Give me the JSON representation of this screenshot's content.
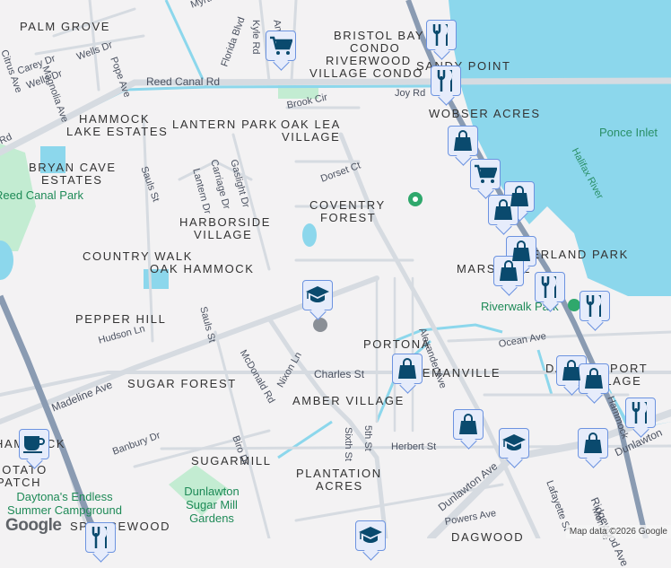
{
  "map": {
    "colors": {
      "land": "#f3f2f3",
      "water": "#8cd7ec",
      "road": "#d6dbe1",
      "highway": "#8a9bb2",
      "park": "#c3ecd2",
      "marker_icon": "#0a4a6e"
    },
    "neighborhoods": [
      "PALM GROVE",
      "BRISTOL BAY",
      "CONDO",
      "RIVERWOOD",
      "VILLAGE CONDO",
      "SANDY POINT",
      "HAMMOCK",
      "LAKE ESTATES",
      "LANTERN PARK",
      "OAK LEA",
      "VILLAGE",
      "WOBSER ACRES",
      "BRYAN CAVE",
      "ESTATES",
      "COVENTRY",
      "FOREST",
      "HARBORSIDE",
      "VILLAGE",
      "COUNTRY WALK",
      "OAK HAMMOCK",
      "RIVERLAND PARK",
      "MARSHALL",
      "PEPPER HILL",
      "PORTONA",
      "FREEMANVILLE",
      "SUGAR FOREST",
      "AMBER VILLAGE",
      "DANIELS PORT",
      "VILLAGE",
      "HAMMOCK",
      "POTATO",
      "PATCH",
      "SUGARMILL",
      "PLANTATION",
      "ACRES",
      "SPRUCEWOOD",
      "DAGWOOD"
    ],
    "streets": [
      "Myrtle",
      "Florida Blvd",
      "Kyle Rd",
      "Anastasia",
      "Carey Dr",
      "Wells Dr",
      "Wells Dr",
      "Magnolia Ave",
      "Pope Ave",
      "Citrus Ave",
      "Reed Canal Rd",
      "Joy Rd",
      "Brook Cir",
      "Sauls St",
      "Lantern Dr",
      "Carriage Dr",
      "Gaslight Dr",
      "Dorset Ct",
      "Sauls St",
      "McDonald Rd",
      "Hudson Ln",
      "Alexander Ave",
      "Ocean Ave",
      "Charles St",
      "Nixon Ln",
      "Madeline Ave",
      "Sixth St",
      "5th St",
      "Biro Dr",
      "Banbury Dr",
      "Herbert St",
      "Dunlawton Ave",
      "Powers Ave",
      "Lafayette St",
      "Monroe",
      "Ridgewood Ave",
      "Dunlawton",
      "Hammock",
      "Rd"
    ],
    "parks": [
      "Reed Canal Park",
      "Riverwalk Park",
      "Daytona's Endless Summer Campground",
      "Dunlawton Sugar Mill Gardens"
    ],
    "water_labels": [
      "Halifax River",
      "Ponce Inlet"
    ],
    "attribution": "Map data ©2026 Google",
    "logo": "Google",
    "markers": [
      {
        "type": "shopping-cart"
      },
      {
        "type": "restaurant"
      },
      {
        "type": "restaurant"
      },
      {
        "type": "shopping-bag"
      },
      {
        "type": "shopping-cart"
      },
      {
        "type": "shopping-bag"
      },
      {
        "type": "shopping-bag"
      },
      {
        "type": "shopping-bag"
      },
      {
        "type": "shopping-bag"
      },
      {
        "type": "restaurant"
      },
      {
        "type": "restaurant"
      },
      {
        "type": "school"
      },
      {
        "type": "shopping-bag"
      },
      {
        "type": "shopping-bag"
      },
      {
        "type": "shopping-bag"
      },
      {
        "type": "restaurant"
      },
      {
        "type": "shopping-bag"
      },
      {
        "type": "school"
      },
      {
        "type": "shopping-bag"
      },
      {
        "type": "cafe"
      },
      {
        "type": "restaurant"
      },
      {
        "type": "school"
      }
    ]
  }
}
